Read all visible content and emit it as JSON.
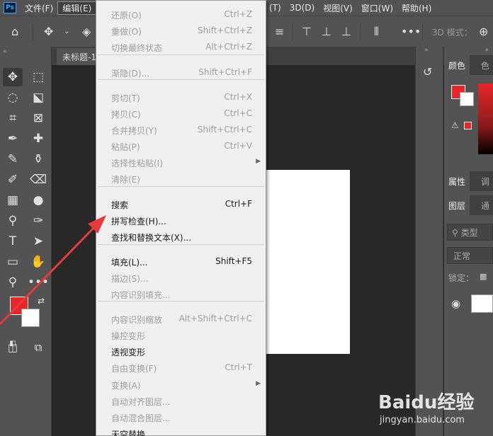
{
  "app": {
    "logo": "Ps"
  },
  "menubar": {
    "items": [
      "文件(F)",
      "编辑(E)"
    ],
    "items_right": [
      "(T)",
      "3D(D)",
      "视图(V)",
      "窗口(W)",
      "帮助(H)"
    ]
  },
  "options_bar": {
    "mode_label": "3D 模式："
  },
  "document": {
    "tab_title": "未标题-1"
  },
  "right_panels": {
    "color_tab": "颜色",
    "color_tab2": "色",
    "props_tab": "属性",
    "props_tab2": "调",
    "layers_tab": "图层",
    "layers_tab2": "通",
    "layer_filter": "类型",
    "blend_mode": "正常",
    "lock_label": "锁定："
  },
  "colors": {
    "foreground": "#e8262a",
    "background": "#ffffff",
    "accent": "#31a8ff",
    "annotation_arrow": "#e83a3a"
  },
  "edit_menu": {
    "items": [
      {
        "label": "还原(O)",
        "shortcut": "Ctrl+Z",
        "enabled": false
      },
      {
        "label": "重做(O)",
        "shortcut": "Shift+Ctrl+Z",
        "enabled": false
      },
      {
        "label": "切换最终状态",
        "shortcut": "Alt+Ctrl+Z",
        "enabled": false
      },
      {
        "label": "渐隐(D)...",
        "shortcut": "Shift+Ctrl+F",
        "enabled": false
      },
      {
        "label": "剪切(T)",
        "shortcut": "Ctrl+X",
        "enabled": false
      },
      {
        "label": "拷贝(C)",
        "shortcut": "Ctrl+C",
        "enabled": false
      },
      {
        "label": "合并拷贝(Y)",
        "shortcut": "Shift+Ctrl+C",
        "enabled": false
      },
      {
        "label": "粘贴(P)",
        "shortcut": "Ctrl+V",
        "enabled": false
      },
      {
        "label": "选择性粘贴(I)",
        "shortcut": "",
        "enabled": false,
        "submenu": true
      },
      {
        "label": "清除(E)",
        "shortcut": "",
        "enabled": false
      },
      {
        "label": "搜索",
        "shortcut": "Ctrl+F",
        "enabled": true
      },
      {
        "label": "拼写检查(H)...",
        "shortcut": "",
        "enabled": true
      },
      {
        "label": "查找和替换文本(X)...",
        "shortcut": "",
        "enabled": true
      },
      {
        "label": "填充(L)...",
        "shortcut": "Shift+F5",
        "enabled": true
      },
      {
        "label": "描边(S)...",
        "shortcut": "",
        "enabled": false
      },
      {
        "label": "内容识别填充...",
        "shortcut": "",
        "enabled": false
      },
      {
        "label": "内容识别缩放",
        "shortcut": "Alt+Shift+Ctrl+C",
        "enabled": false
      },
      {
        "label": "操控变形",
        "shortcut": "",
        "enabled": false
      },
      {
        "label": "透视变形",
        "shortcut": "",
        "enabled": true
      },
      {
        "label": "自由变换(F)",
        "shortcut": "Ctrl+T",
        "enabled": false
      },
      {
        "label": "变换(A)",
        "shortcut": "",
        "enabled": false,
        "submenu": true
      },
      {
        "label": "自动对齐图层...",
        "shortcut": "",
        "enabled": false
      },
      {
        "label": "自动混合图层...",
        "shortcut": "",
        "enabled": false
      },
      {
        "label": "天空替换...",
        "shortcut": "",
        "enabled": true
      }
    ]
  },
  "watermark": {
    "brand": "Baidu经验",
    "url": "jingyan.baidu.com"
  }
}
